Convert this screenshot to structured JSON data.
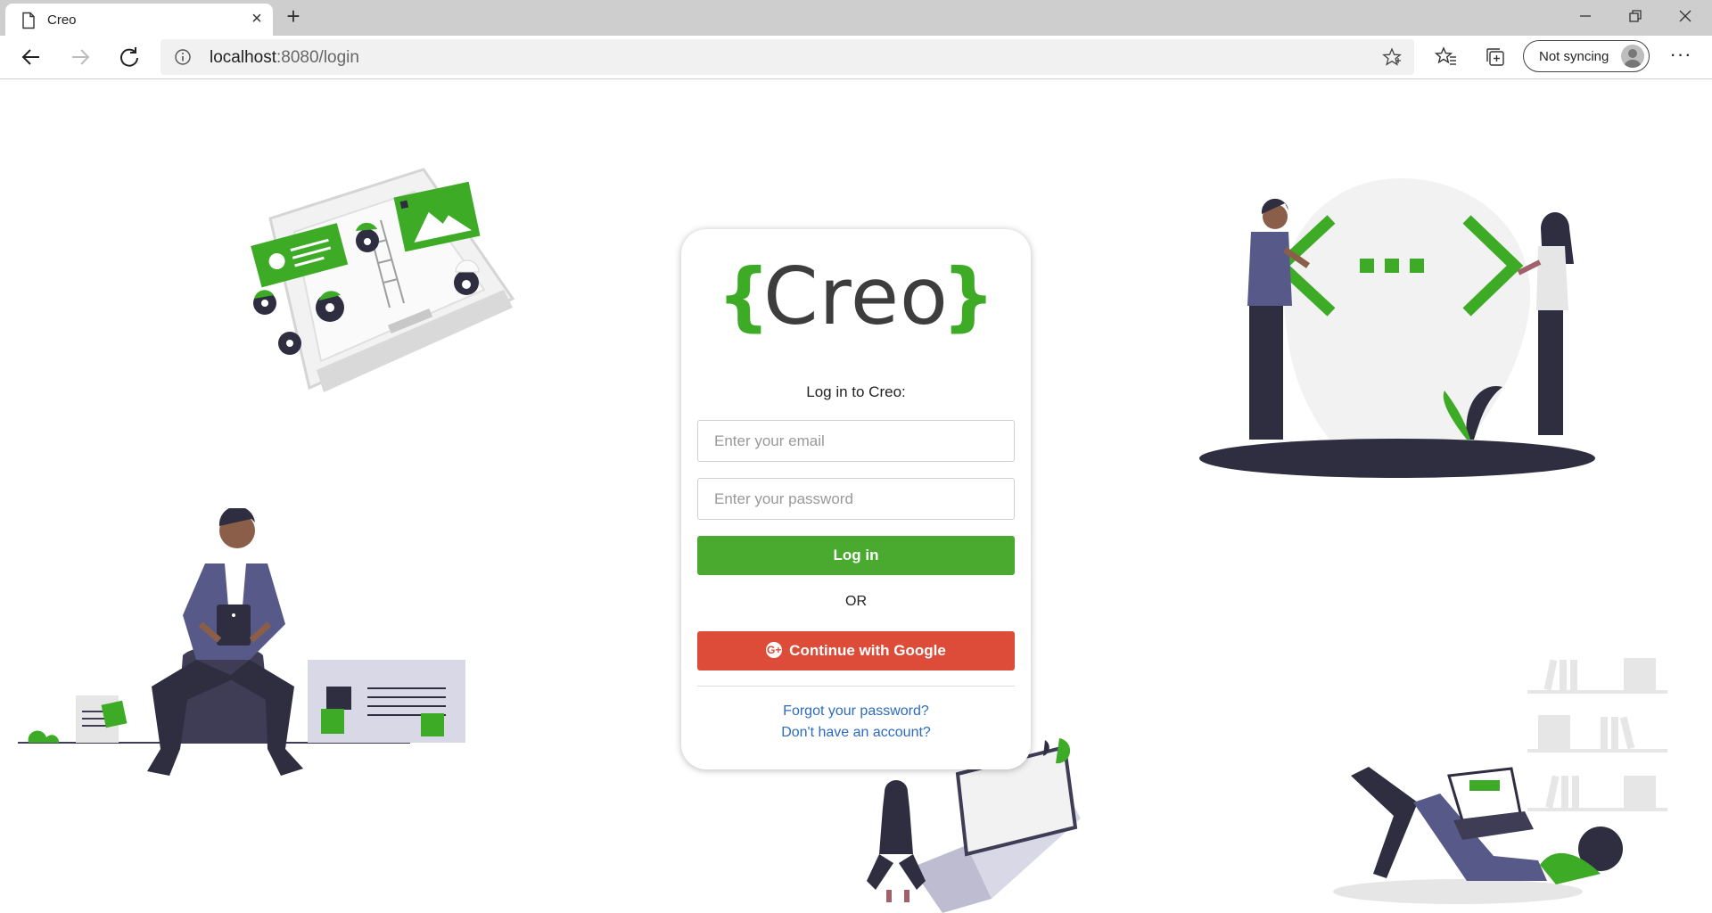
{
  "browser": {
    "tab_title": "Creo",
    "new_tab_symbol": "+",
    "close_symbol": "×",
    "url_host": "localhost",
    "url_path": ":8080/login",
    "sync_label": "Not syncing",
    "more_symbol": "···"
  },
  "login": {
    "logo_left_brace": "{",
    "logo_text": "Creo",
    "logo_right_brace": "}",
    "heading": "Log in to Creo:",
    "email_placeholder": "Enter your email",
    "password_placeholder": "Enter your password",
    "login_label": "Log in",
    "or_label": "OR",
    "google_icon_glyph": "G+",
    "google_label": "Continue with Google",
    "forgot_label": "Forgot your password?",
    "signup_label": "Don't have an account?"
  },
  "colors": {
    "brand_green": "#3dab26",
    "login_button": "#4aa92f",
    "google_button": "#dd4b39",
    "link": "#2c6bbf",
    "illustration_dark": "#2f2e41",
    "illustration_purple": "#575a89"
  }
}
